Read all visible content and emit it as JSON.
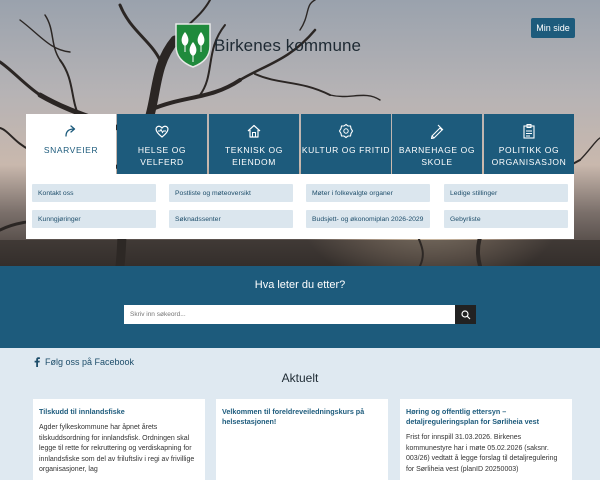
{
  "header": {
    "site_title": "Birkenes kommune",
    "min_side_label": "Min side"
  },
  "tabs": [
    {
      "label": "SNARVEIER",
      "icon": "share-arrow-icon",
      "active": true
    },
    {
      "label": "HELSE OG VELFERD",
      "icon": "heart-pulse-icon",
      "active": false
    },
    {
      "label": "TEKNISK OG EIENDOM",
      "icon": "house-icon",
      "active": false
    },
    {
      "label": "KULTUR OG FRITID",
      "icon": "badge-star-icon",
      "active": false
    },
    {
      "label": "BARNEHAGE OG SKOLE",
      "icon": "pencil-ruler-icon",
      "active": false
    },
    {
      "label": "POLITIKK OG ORGANISASJON",
      "icon": "clipboard-icon",
      "active": false
    }
  ],
  "quick_links": [
    "Kontakt oss",
    "Postliste og møteoversikt",
    "Møter i folkevalgte organer",
    "Ledige stillinger",
    "Kunngjøringer",
    "Søknadssenter",
    "Budsjett- og økonomiplan 2026-2029",
    "Gebyrliste"
  ],
  "search": {
    "heading": "Hva leter du etter?",
    "placeholder": "Skriv inn søkeord..."
  },
  "facebook_label": "Følg oss på Facebook",
  "news": {
    "title": "Aktuelt",
    "cards": [
      {
        "title": "Tilskudd til innlandsfiske",
        "text": "Agder fylkeskommune har åpnet årets tilskuddsordning for innlandsfisk. Ordningen skal legge til rette for rekruttering og verdiskapning for innlandsfiske som del av friluftsliv i regi av frivillige organisasjoner, lag"
      },
      {
        "title": "Velkommen til foreldreveiledningskurs på helsestasjonen!",
        "text": ""
      },
      {
        "title": "Høring og offentlig ettersyn – detaljreguleringsplan for Sørliheia vest",
        "text": "Frist for innspill 31.03.2026. Birkenes kommunestyre har i møte 05.02.2026 (saksnr. 003/26) vedtatt å legge forslag til detaljregulering for Sørliheia vest (planID 20250003)"
      }
    ]
  },
  "colors": {
    "brand_blue": "#1d5b7c",
    "link_bg": "#dbe6ee",
    "page_bg": "#dfe9f1"
  }
}
